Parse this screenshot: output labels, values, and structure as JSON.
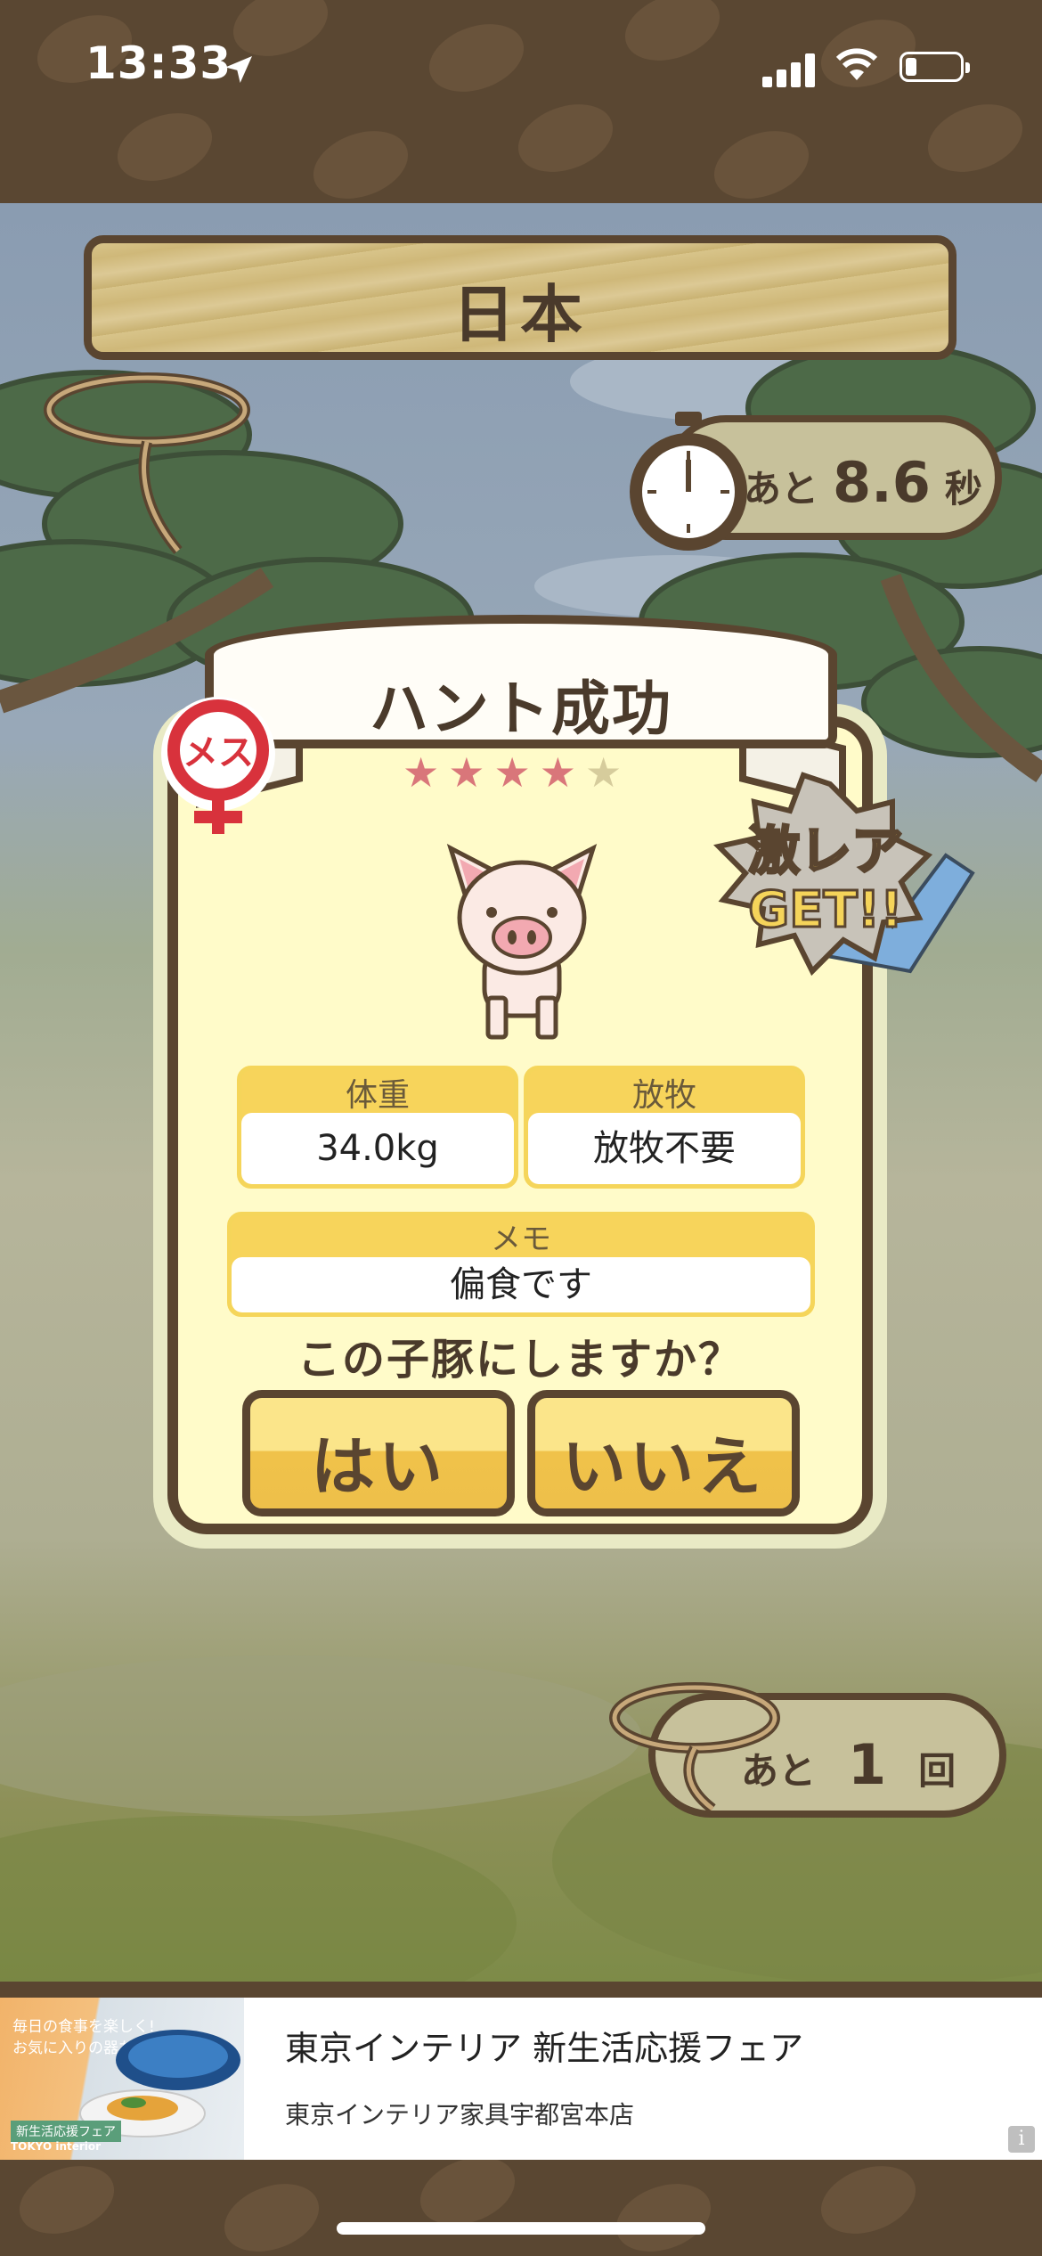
{
  "status_bar": {
    "time": "13:33"
  },
  "title": "日本",
  "timer": {
    "prefix": "あと",
    "value": "8.6",
    "unit": "秒"
  },
  "result": {
    "banner": "ハント成功",
    "gender": "メス",
    "stars": [
      "★",
      "★",
      "★",
      "★",
      "★"
    ],
    "rare_badge_line1": "激レア",
    "rare_badge_line2": "GET!!"
  },
  "fields": {
    "weight": {
      "label": "体重",
      "value": "34.0kg"
    },
    "grazing": {
      "label": "放牧",
      "value": "放牧不要"
    },
    "memo": {
      "label": "メモ",
      "value": "偏食です"
    }
  },
  "question": "この子豚にしますか？",
  "buttons": {
    "yes": "はい",
    "no": "いいえ"
  },
  "attempts": {
    "prefix": "あと",
    "value": "1",
    "unit": "回"
  },
  "ad": {
    "title": "東京インテリア 新生活応援フェア",
    "subtitle": "東京インテリア家具宇都宮本店",
    "image_line1": "毎日の食事を楽しく!",
    "image_line2": "お気に入りの器たち",
    "image_tag": "新生活応援フェア",
    "image_brand": "TOKYO interior",
    "info": "i"
  },
  "colors": {
    "frame_brown": "#5a4530",
    "card_fill": "#fffbc9",
    "button_yellow": "#f0c24a",
    "star_pink": "#d9767a"
  }
}
